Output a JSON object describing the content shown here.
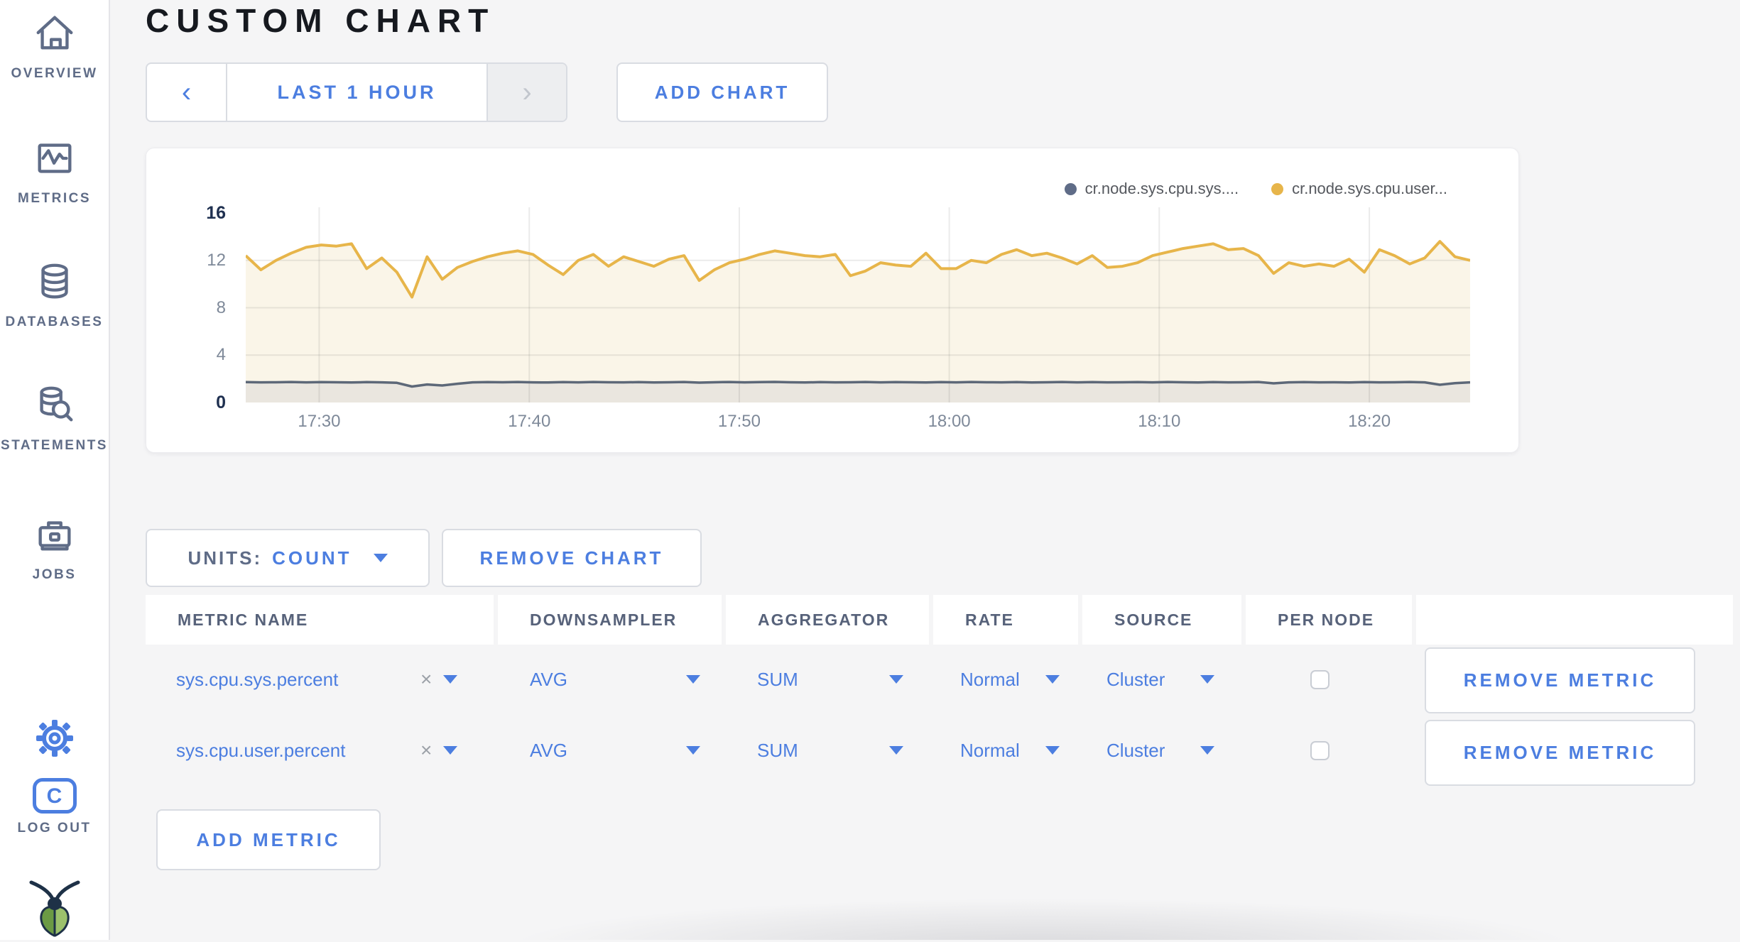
{
  "colors": {
    "accent_blue": "#4C7EE0",
    "logout_blue": "#1B38E0",
    "sidebar_icon": "#5F6C87",
    "series_sys": "#5F6C87",
    "series_user": "#E7B54A",
    "fill_user": "#FAF5E8",
    "fill_sys": "#EAE6DF",
    "grid": "rgba(60,60,60,0.10)"
  },
  "sidebar": {
    "items": [
      {
        "label": "OVERVIEW",
        "icon": "home-icon"
      },
      {
        "label": "METRICS",
        "icon": "metrics-icon"
      },
      {
        "label": "DATABASES",
        "icon": "database-icon"
      },
      {
        "label": "STATEMENTS",
        "icon": "statements-icon"
      },
      {
        "label": "JOBS",
        "icon": "jobs-icon"
      }
    ],
    "settings_icon": "gear-icon",
    "logout": {
      "label": "LOG OUT",
      "badge": "C"
    },
    "logo": "cockroach-logo"
  },
  "header": {
    "title": "CUSTOM CHART",
    "time_selector": {
      "prev": "‹",
      "label": "LAST 1 HOUR",
      "next": "›"
    },
    "add_chart_label": "ADD CHART"
  },
  "chart_data": {
    "type": "line",
    "title": "",
    "xlabel": "",
    "ylabel": "",
    "ylim": [
      0,
      16
    ],
    "grid": true,
    "legend_position": "top-right",
    "legend": [
      {
        "label": "cr.node.sys.cpu.sys....",
        "color": "#5F6C87"
      },
      {
        "label": "cr.node.sys.cpu.user...",
        "color": "#E7B54A"
      }
    ],
    "y_ticks": [
      {
        "label": "16",
        "value": 16,
        "bold": true,
        "gridline": false
      },
      {
        "label": "12",
        "value": 12,
        "bold": false,
        "gridline": true
      },
      {
        "label": "8",
        "value": 8,
        "bold": false,
        "gridline": true
      },
      {
        "label": "4",
        "value": 4,
        "bold": false,
        "gridline": true
      },
      {
        "label": "0",
        "value": 0,
        "bold": true,
        "gridline": false
      }
    ],
    "x_ticks": [
      {
        "label": "17:30",
        "frac": 0.06
      },
      {
        "label": "17:40",
        "frac": 0.2316
      },
      {
        "label": "17:50",
        "frac": 0.4031
      },
      {
        "label": "18:00",
        "frac": 0.5746
      },
      {
        "label": "18:10",
        "frac": 0.7461
      },
      {
        "label": "18:20",
        "frac": 0.9177
      }
    ],
    "series": [
      {
        "name": "cr.node.sys.cpu.user.percent",
        "color": "#E7B54A",
        "fill": "#FAF5E8",
        "values": [
          12.4,
          11.2,
          12.0,
          12.6,
          13.1,
          13.3,
          13.2,
          13.4,
          11.3,
          12.2,
          11.0,
          8.9,
          12.3,
          10.4,
          11.4,
          11.9,
          12.3,
          12.6,
          12.8,
          12.5,
          11.6,
          10.8,
          12.0,
          12.5,
          11.5,
          12.3,
          11.9,
          11.5,
          12.1,
          12.4,
          10.3,
          11.2,
          11.8,
          12.1,
          12.5,
          12.8,
          12.6,
          12.4,
          12.3,
          12.5,
          10.7,
          11.1,
          11.8,
          11.6,
          11.5,
          12.6,
          11.3,
          11.3,
          12.0,
          11.8,
          12.5,
          12.9,
          12.4,
          12.6,
          12.2,
          11.7,
          12.4,
          11.4,
          11.5,
          11.8,
          12.4,
          12.7,
          13.0,
          13.2,
          13.4,
          12.9,
          13.0,
          12.4,
          10.9,
          11.8,
          11.5,
          11.7,
          11.5,
          12.1,
          11.0,
          12.9,
          12.4,
          11.7,
          12.2,
          13.6,
          12.3,
          12.0
        ]
      },
      {
        "name": "cr.node.sys.cpu.sys.percent",
        "color": "#5D6878",
        "fill": "#EAE6DF",
        "values": [
          1.72,
          1.7,
          1.71,
          1.73,
          1.7,
          1.72,
          1.71,
          1.69,
          1.72,
          1.7,
          1.66,
          1.35,
          1.52,
          1.44,
          1.58,
          1.7,
          1.72,
          1.71,
          1.73,
          1.7,
          1.69,
          1.72,
          1.7,
          1.73,
          1.71,
          1.7,
          1.72,
          1.69,
          1.71,
          1.73,
          1.68,
          1.71,
          1.73,
          1.7,
          1.72,
          1.74,
          1.71,
          1.69,
          1.72,
          1.7,
          1.71,
          1.73,
          1.7,
          1.72,
          1.71,
          1.69,
          1.72,
          1.7,
          1.73,
          1.71,
          1.7,
          1.72,
          1.69,
          1.71,
          1.73,
          1.7,
          1.72,
          1.7,
          1.71,
          1.72,
          1.7,
          1.73,
          1.71,
          1.69,
          1.72,
          1.7,
          1.71,
          1.73,
          1.62,
          1.7,
          1.72,
          1.7,
          1.71,
          1.69,
          1.72,
          1.7,
          1.71,
          1.73,
          1.7,
          1.5,
          1.63,
          1.7
        ]
      }
    ]
  },
  "controls": {
    "units_label": "UNITS:",
    "units_value": "COUNT",
    "remove_chart_label": "REMOVE CHART",
    "add_metric_label": "ADD METRIC"
  },
  "table": {
    "headers": [
      "METRIC NAME",
      "DOWNSAMPLER",
      "AGGREGATOR",
      "RATE",
      "SOURCE",
      "PER NODE"
    ],
    "remove_glyph": "×",
    "rows": [
      {
        "metric_name": "sys.cpu.sys.percent",
        "downsampler": "AVG",
        "aggregator": "SUM",
        "rate": "Normal",
        "source": "Cluster",
        "per_node_checked": false,
        "action": "REMOVE METRIC"
      },
      {
        "metric_name": "sys.cpu.user.percent",
        "downsampler": "AVG",
        "aggregator": "SUM",
        "rate": "Normal",
        "source": "Cluster",
        "per_node_checked": false,
        "action": "REMOVE METRIC"
      }
    ]
  }
}
